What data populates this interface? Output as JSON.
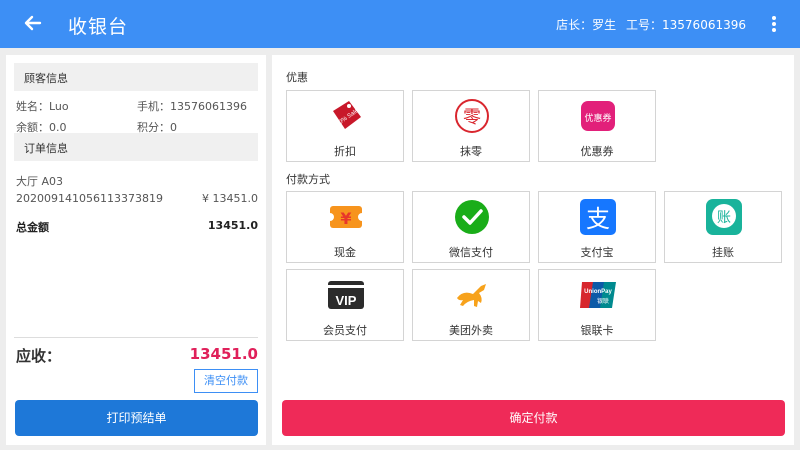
{
  "header": {
    "title": "收银台",
    "manager": "店长：罗生",
    "staff_id": "工号：13576061396"
  },
  "customer": {
    "section_title": "顾客信息",
    "name": "姓名：Luo",
    "phone": "手机：13576061396",
    "balance": "余额：0.0",
    "points": "积分：0"
  },
  "order": {
    "section_title": "订单信息",
    "table": "大厅 A03",
    "order_no": "20200914105611337381​9",
    "order_amount": "¥ 13451.0",
    "total_label": "总金额",
    "total_value": "13451.0"
  },
  "summary": {
    "due_label": "应收：",
    "due_amount": "13451.0",
    "clear_label": "清空付款",
    "print_label": "打印预结单"
  },
  "discounts": {
    "label": "优惠",
    "items": [
      {
        "label": "折扣",
        "icon": "discount-tag-icon"
      },
      {
        "label": "抹零",
        "icon": "zero-icon"
      },
      {
        "label": "优惠券",
        "icon": "coupon-icon"
      }
    ]
  },
  "payments": {
    "label": "付款方式",
    "items": [
      {
        "label": "现金",
        "icon": "cash-icon"
      },
      {
        "label": "微信支付",
        "icon": "wechat-pay-icon"
      },
      {
        "label": "支付宝",
        "icon": "alipay-icon"
      },
      {
        "label": "挂账",
        "icon": "credit-account-icon"
      },
      {
        "label": "会员支付",
        "icon": "vip-icon"
      },
      {
        "label": "美团外卖",
        "icon": "meituan-icon"
      },
      {
        "label": "银联卡",
        "icon": "unionpay-icon"
      }
    ]
  },
  "icon_text": {
    "sale_tag": "50% Sale",
    "zero": "零",
    "coupon": "优惠券",
    "cash": "¥",
    "alipay": "支",
    "credit": "账",
    "vip": "VIP",
    "unionpay": "UnionPay",
    "unionpay_cn": "银联"
  },
  "confirm_label": "确定付款",
  "colors": {
    "primary": "#3d8ff5",
    "print_button": "#1e78d8",
    "confirm_button": "#ef2a58",
    "amount": "#e0205a"
  }
}
